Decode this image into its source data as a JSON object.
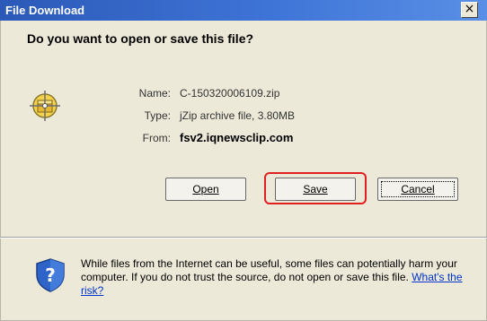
{
  "window": {
    "title": "File Download",
    "close_label": "×"
  },
  "dialog": {
    "question": "Do you want to open or save this file?",
    "fields": [
      {
        "label": "Name:",
        "value": "C-150320006109.zip"
      },
      {
        "label": "Type:",
        "value": "jZip archive file, 3.80MB"
      },
      {
        "label": "From:",
        "value": "fsv2.iqnewsclip.com"
      }
    ],
    "buttons": {
      "open_label": "Open",
      "save_label": "Save",
      "cancel_label": "Cancel"
    },
    "warning": {
      "text": "While files from the Internet can be useful, some files can potentially harm your computer. If you do not trust the source, do not open or save this file.",
      "link": "What's the risk?"
    }
  },
  "colors": {
    "title_bar": "#3e74d6",
    "dialog_bg": "#ece9d8",
    "highlight": "#e02020",
    "link": "#0033cc"
  },
  "icons": {
    "file_type": "zip-file-icon",
    "security": "shield-question-icon",
    "close": "close-icon"
  }
}
